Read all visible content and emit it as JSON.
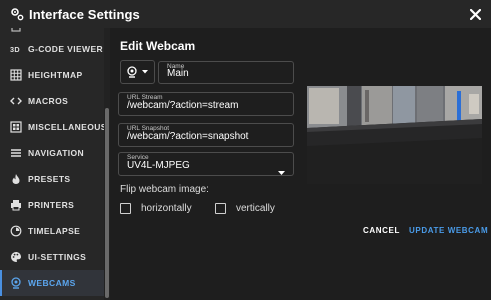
{
  "dialog": {
    "title": "Interface Settings"
  },
  "sidebar": {
    "items": [
      {
        "label": "G-CODE VIEWER",
        "icon": "3d-icon",
        "active": false
      },
      {
        "label": "HEIGHTMAP",
        "icon": "grid-icon",
        "active": false
      },
      {
        "label": "MACROS",
        "icon": "code-icon",
        "active": false
      },
      {
        "label": "MISCELLANEOUS",
        "icon": "miscellaneous-icon",
        "active": false
      },
      {
        "label": "NAVIGATION",
        "icon": "menu-icon",
        "active": false
      },
      {
        "label": "PRESETS",
        "icon": "fire-icon",
        "active": false
      },
      {
        "label": "PRINTERS",
        "icon": "printer-icon",
        "active": false
      },
      {
        "label": "TIMELAPSE",
        "icon": "timelapse-icon",
        "active": false
      },
      {
        "label": "UI-SETTINGS",
        "icon": "palette-icon",
        "active": false
      },
      {
        "label": "WEBCAMS",
        "icon": "webcam-icon",
        "active": true
      }
    ]
  },
  "form": {
    "heading": "Edit Webcam",
    "name": {
      "label": "Name",
      "value": "Main"
    },
    "url_stream": {
      "label": "URL Stream",
      "value": "/webcam/?action=stream"
    },
    "url_snapshot": {
      "label": "URL Snapshot",
      "value": "/webcam/?action=snapshot"
    },
    "service": {
      "label": "Service",
      "value": "UV4L-MJPEG"
    },
    "flip_label": "Flip webcam image:",
    "horizontally": "horizontally",
    "vertically": "vertically"
  },
  "actions": {
    "cancel": "CANCEL",
    "update": "UPDATE WEBCAM"
  },
  "colors": {
    "accent": "#4a90e2",
    "background": "#1e1e1e",
    "sidebar": "#272727"
  }
}
